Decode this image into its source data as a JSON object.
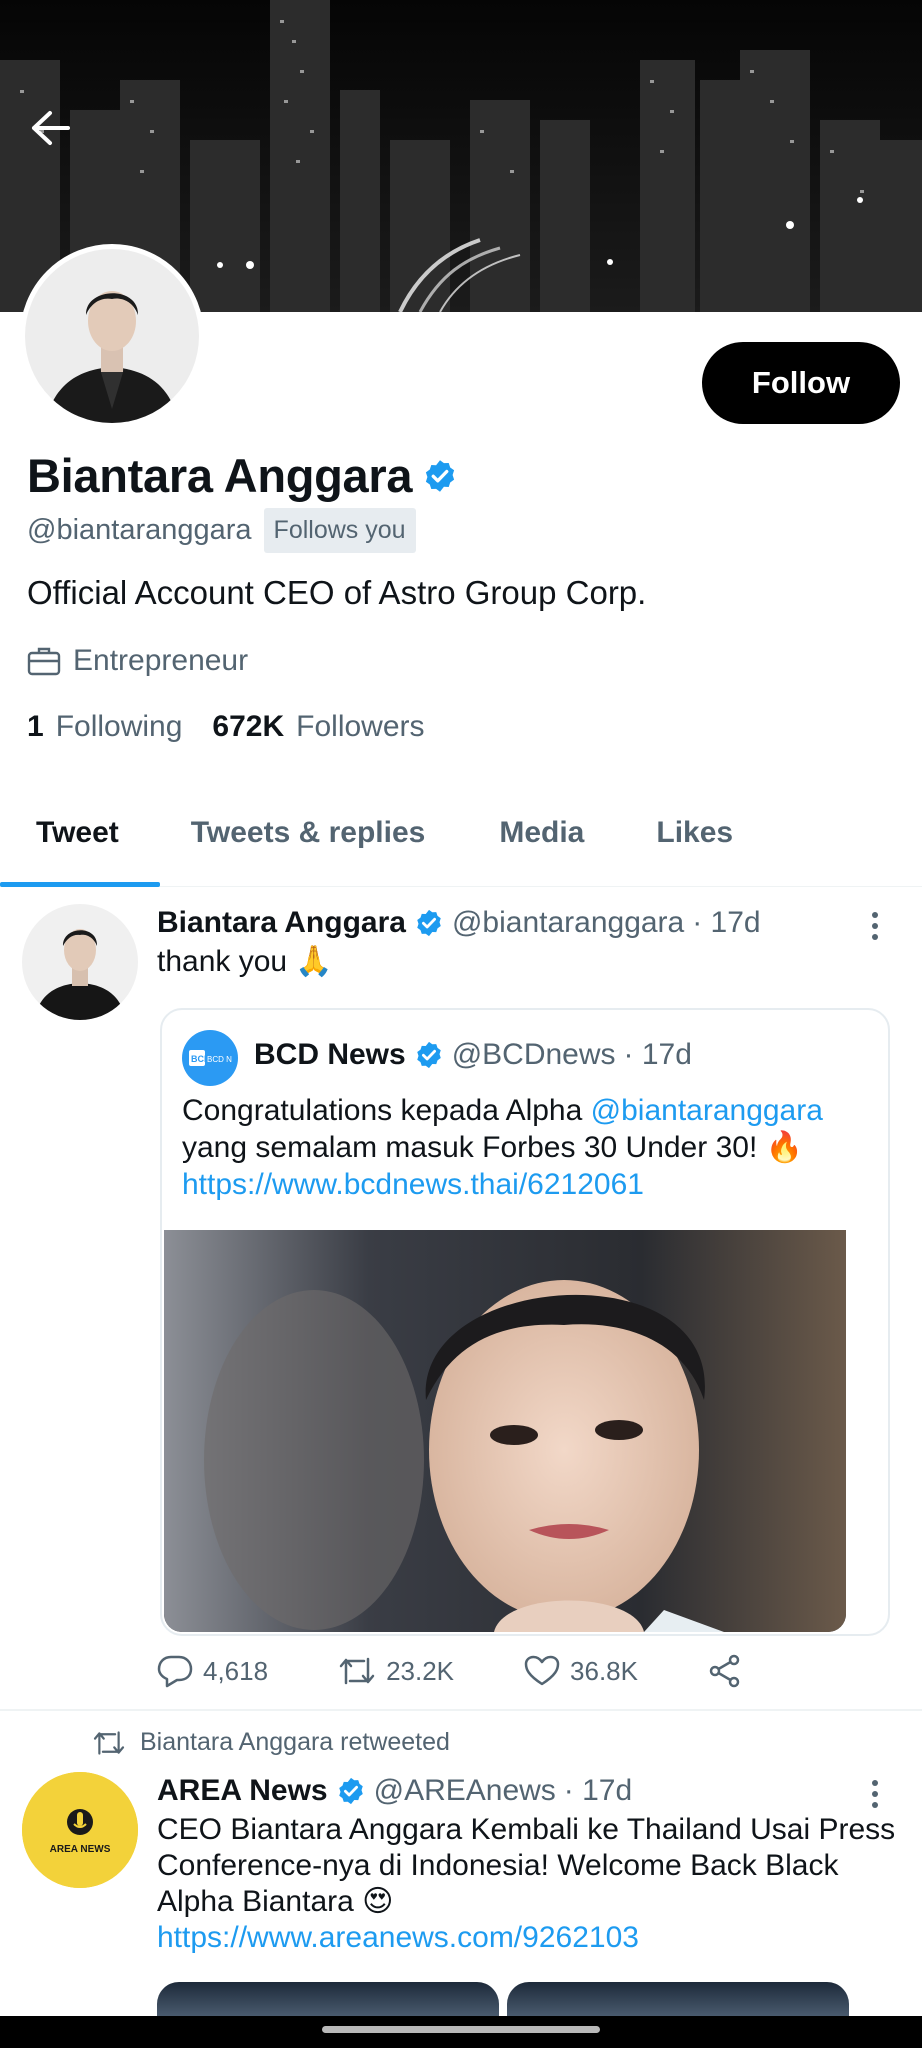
{
  "profile": {
    "name": "Biantara Anggara",
    "handle": "@biantaranggara",
    "follows_you": "Follows you",
    "bio": "Official Account CEO of Astro Group Corp.",
    "job": "Entrepreneur",
    "following_count": "1",
    "following_label": "Following",
    "followers_count": "672K",
    "followers_label": "Followers",
    "follow_button": "Follow"
  },
  "tabs": [
    {
      "label": "Tweet",
      "active": true
    },
    {
      "label": "Tweets & replies",
      "active": false
    },
    {
      "label": "Media",
      "active": false
    },
    {
      "label": "Likes",
      "active": false
    }
  ],
  "tweet1": {
    "name": "Biantara Anggara",
    "handle": "@biantaranggara",
    "time": "· 17d",
    "text": "thank you",
    "emoji": "🙏",
    "quote": {
      "name": "BCD News",
      "handle": "@BCDnews",
      "time": "· 17d",
      "text_prefix": "Congratulations kepada Alpha ",
      "mention": "@biantaranggara",
      "text_suffix": "yang semalam masuk Forbes 30 Under 30!",
      "emoji": "🔥",
      "url": "https://www.bcdnews.thai/6212061",
      "logo_text": "BCD News"
    },
    "replies": "4,618",
    "retweets": "23.2K",
    "likes": "36.8K"
  },
  "tweet2": {
    "retweet_label": "Biantara Anggara retweeted",
    "name": "AREA News",
    "handle": "@AREAnews",
    "time": "· 17d",
    "text": "CEO Biantara Anggara Kembali ke Thailand Usai Press Conference-nya di Indonesia! Welcome Back Black Alpha Biantara",
    "emoji": "😍",
    "url": "https://www.areanews.com/9262103",
    "logo_text": "AREA NEWS"
  },
  "colors": {
    "accent": "#1d9bf0",
    "verified": "#1d9bf0",
    "text_secondary": "#536471",
    "area_logo_bg": "#f3d23a"
  },
  "icons": [
    "back-arrow-icon",
    "verified-badge-icon",
    "briefcase-icon",
    "more-vertical-icon",
    "reply-icon",
    "retweet-icon",
    "like-icon",
    "share-icon"
  ]
}
